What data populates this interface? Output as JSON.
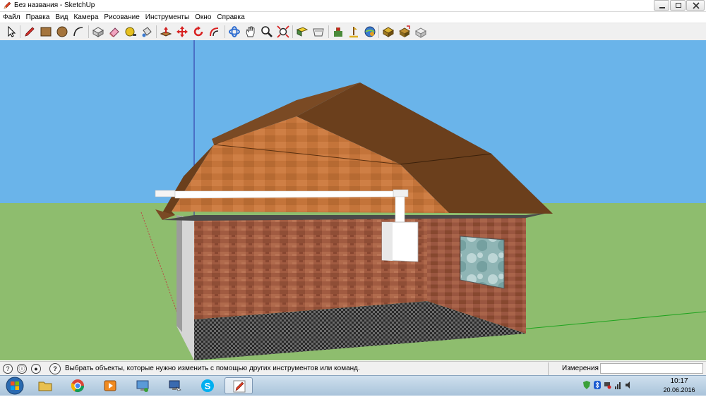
{
  "window": {
    "title": "Без названия - SketchUp",
    "icon": "sketchup-pencil-icon"
  },
  "menu": [
    "Файл",
    "Правка",
    "Вид",
    "Камера",
    "Рисование",
    "Инструменты",
    "Окно",
    "Справка"
  ],
  "toolbar": {
    "tools": [
      "select-icon",
      "line-icon",
      "rectangle-icon",
      "circle-icon",
      "arc-icon",
      "make-component-icon",
      "eraser-icon",
      "tape-measure-icon",
      "paint-bucket-icon",
      "push-pull-icon",
      "move-icon",
      "rotate-icon",
      "offset-icon",
      "orbit-icon",
      "pan-icon",
      "zoom-icon",
      "zoom-extents-icon",
      "previous-view-icon",
      "next-view-icon",
      "add-location-icon",
      "toggle-terrain-icon",
      "get-models-icon",
      "share-model-icon",
      "extension-warehouse-icon",
      "share-component-icon"
    ]
  },
  "status": {
    "message": "Выбрать объекты, которые нужно изменить с помощью других инструментов или команд.",
    "measurements_label": "Измерения",
    "measurements_value": "",
    "icons": [
      "geo-location-icon",
      "credits-icon",
      "user-icon",
      "help-icon"
    ]
  },
  "taskbar": {
    "apps": [
      "windows-explorer-icon",
      "chrome-icon",
      "media-player-icon",
      "network-icon",
      "remote-desktop-icon",
      "skype-icon",
      "sketchup-icon"
    ],
    "active": "sketchup-icon",
    "tray": [
      "shield-icon",
      "bluetooth-icon",
      "network-error-icon",
      "signal-icon",
      "volume-icon"
    ],
    "time": "10:17",
    "date": "20.06.2016"
  },
  "colors": {
    "sky": "#6ab4ea",
    "ground": "#8ebd6e",
    "brick": "#a05a40",
    "roof_dark": "#6b3f1c",
    "gable": "#c06f34",
    "axis_blue": "#2a2aa0",
    "axis_green": "#1fa31f",
    "axis_red": "#b44"
  }
}
